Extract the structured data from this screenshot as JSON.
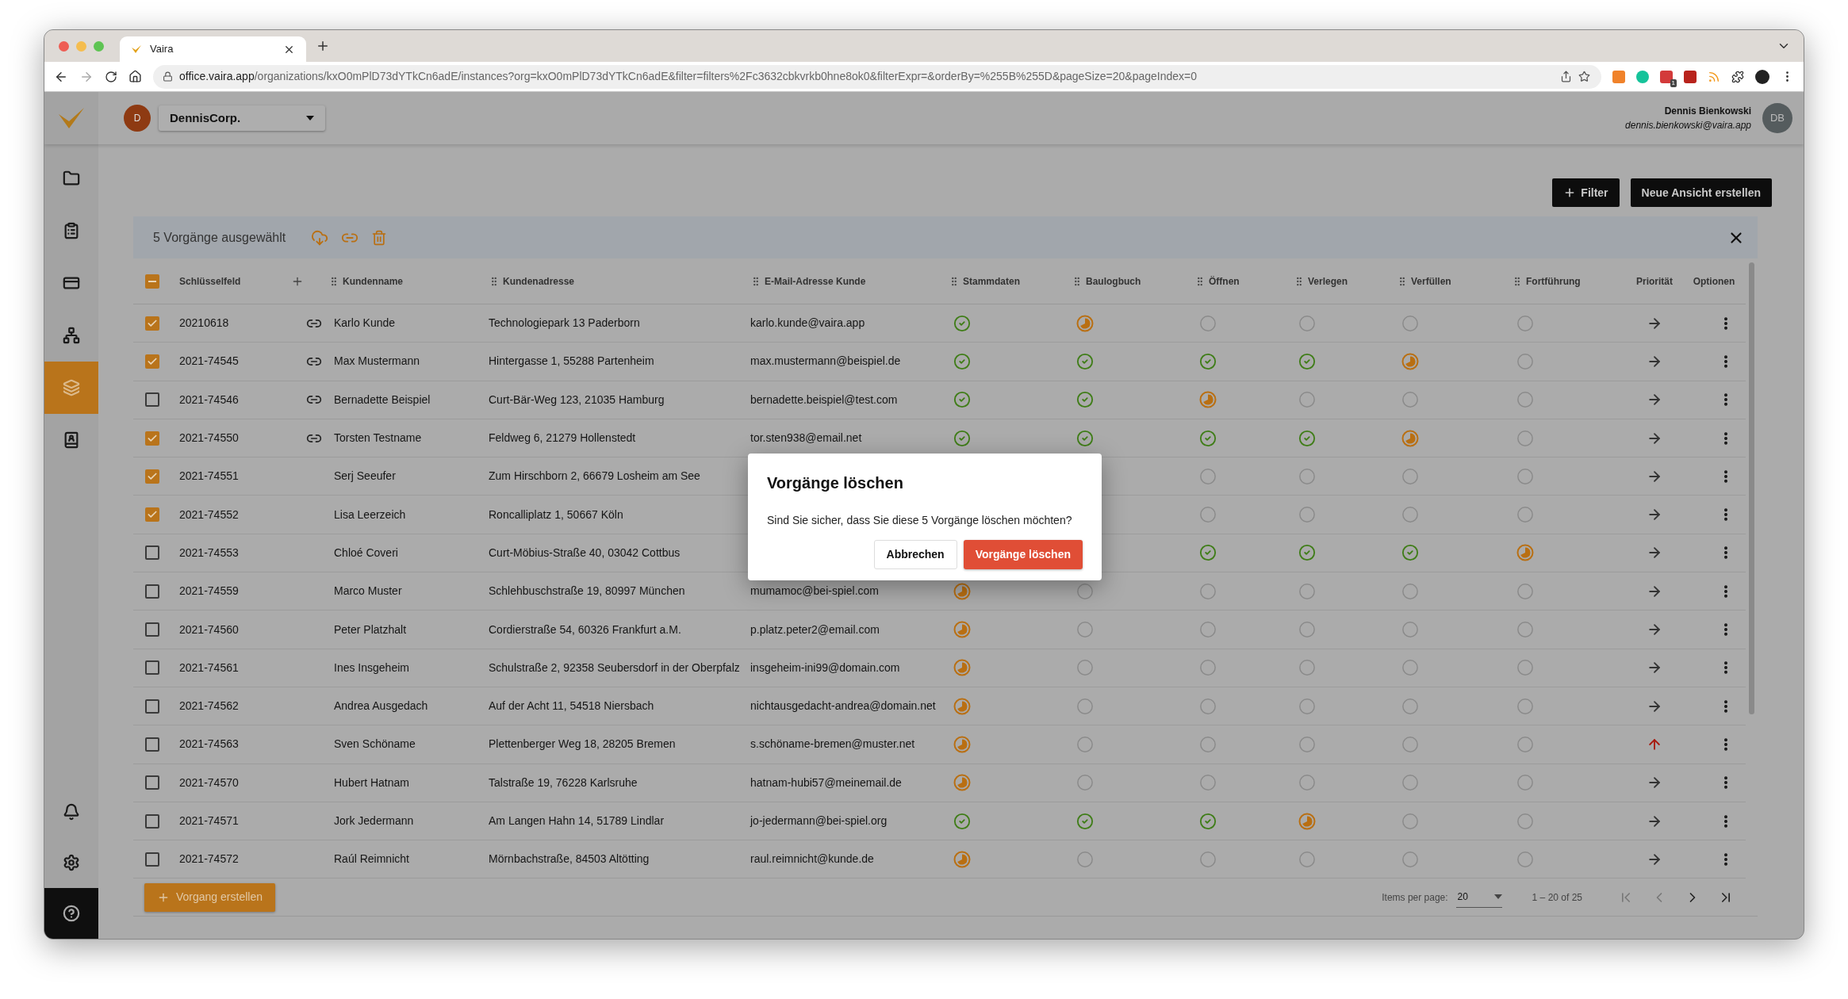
{
  "browser": {
    "tab_title": "Vaira",
    "url_host": "office.vaira.app",
    "url_path": "/organizations/kxO0mPlD73dYTkCn6adE/instances?org=kxO0mPlD73dYTkCn6adE&filter=filters%2Fc3632cbkvrkb0hne8ok0&filterExpr=&orderBy=%255B%255D&pageSize=20&pageIndex=0",
    "extension_badge": "1"
  },
  "app_header": {
    "org_avatar": "D",
    "org": "DennisCorp.",
    "user_name": "Dennis Bienkowski",
    "user_email": "dennis.bienkowski@vaira.app",
    "user_avatar": "DB"
  },
  "sidebar": {
    "items": [
      {
        "kind": "folder",
        "selected": false
      },
      {
        "kind": "clipboard",
        "selected": false
      },
      {
        "kind": "card",
        "selected": false
      },
      {
        "kind": "hierarchy",
        "selected": false
      },
      {
        "kind": "layers",
        "selected": true
      },
      {
        "kind": "contacts",
        "selected": false
      }
    ],
    "bottom_items": [
      {
        "kind": "bell"
      },
      {
        "kind": "settings"
      },
      {
        "kind": "help"
      }
    ]
  },
  "toolbar": {
    "buttons": [
      {
        "label": "Filter",
        "kind": "add"
      },
      {
        "label": "Neue Ansicht erstellen",
        "kind": "plain"
      }
    ]
  },
  "selection_bar": {
    "label": "5 Vorgänge ausgewählt"
  },
  "table": {
    "select_all_indeterminate": true,
    "columns": [
      {
        "label": "Schlüsselfeld",
        "kind": "key"
      },
      {
        "label": "Kundenname",
        "kind": "draggable"
      },
      {
        "label": "Kundenadresse",
        "kind": "draggable"
      },
      {
        "label": "E-Mail-Adresse Kunde",
        "kind": "draggable"
      },
      {
        "label": "Stammdaten",
        "kind": "draggable"
      },
      {
        "label": "Baulogbuch",
        "kind": "draggable"
      },
      {
        "label": "Öffnen",
        "kind": "draggable"
      },
      {
        "label": "Verlegen",
        "kind": "draggable"
      },
      {
        "label": "Verfüllen",
        "kind": "draggable"
      },
      {
        "label": "Fortführung",
        "kind": "draggable"
      },
      {
        "label": "Priorität",
        "kind": "plain"
      },
      {
        "label": "Optionen",
        "kind": "plain"
      }
    ],
    "rows": [
      {
        "checked": true,
        "key": "20210618",
        "linked": true,
        "name": "Karlo Kunde",
        "address": "Technologiepark 13 Paderborn",
        "email": "karlo.kunde@vaira.app",
        "steps": {
          "stammdaten": {
            "kind": "done"
          },
          "baulogbuch": {
            "kind": "partial"
          },
          "oeffnen": {
            "kind": "open"
          },
          "verlegen": {
            "kind": "open"
          },
          "verfuellen": {
            "kind": "open"
          },
          "fortfuehrung": {
            "kind": "open"
          }
        },
        "high_priority": false
      },
      {
        "checked": true,
        "key": "2021-74545",
        "linked": true,
        "name": "Max Mustermann",
        "address": "Hintergasse 1, 55288 Partenheim",
        "email": "max.mustermann@beispiel.de",
        "steps": {
          "stammdaten": {
            "kind": "done"
          },
          "baulogbuch": {
            "kind": "done"
          },
          "oeffnen": {
            "kind": "done"
          },
          "verlegen": {
            "kind": "done"
          },
          "verfuellen": {
            "kind": "partial"
          },
          "fortfuehrung": {
            "kind": "open"
          }
        },
        "high_priority": false
      },
      {
        "checked": false,
        "key": "2021-74546",
        "linked": true,
        "name": "Bernadette Beispiel",
        "address": "Curt-Bär-Weg 123, 21035 Hamburg",
        "email": "bernadette.beispiel@test.com",
        "steps": {
          "stammdaten": {
            "kind": "done"
          },
          "baulogbuch": {
            "kind": "done"
          },
          "oeffnen": {
            "kind": "partial"
          },
          "verlegen": {
            "kind": "open"
          },
          "verfuellen": {
            "kind": "open"
          },
          "fortfuehrung": {
            "kind": "open"
          }
        },
        "high_priority": false
      },
      {
        "checked": true,
        "key": "2021-74550",
        "linked": true,
        "name": "Torsten Testname",
        "address": "Feldweg 6, 21279 Hollenstedt",
        "email": "tor.sten938@email.net",
        "steps": {
          "stammdaten": {
            "kind": "done"
          },
          "baulogbuch": {
            "kind": "done"
          },
          "oeffnen": {
            "kind": "done"
          },
          "verlegen": {
            "kind": "done"
          },
          "verfuellen": {
            "kind": "partial"
          },
          "fortfuehrung": {
            "kind": "open"
          }
        },
        "high_priority": false
      },
      {
        "checked": true,
        "key": "2021-74551",
        "linked": false,
        "name": "Serj Seeufer",
        "address": "Zum Hirschborn 2, 66679 Losheim am See",
        "steps": {
          "oeffnen": {
            "kind": "open"
          },
          "verlegen": {
            "kind": "open"
          },
          "verfuellen": {
            "kind": "open"
          },
          "fortfuehrung": {
            "kind": "open"
          }
        },
        "high_priority": false
      },
      {
        "checked": true,
        "key": "2021-74552",
        "linked": false,
        "name": "Lisa Leerzeich",
        "address": "Roncalliplatz 1, 50667 Köln",
        "steps": {
          "oeffnen": {
            "kind": "open"
          },
          "verlegen": {
            "kind": "open"
          },
          "verfuellen": {
            "kind": "open"
          },
          "fortfuehrung": {
            "kind": "open"
          }
        },
        "high_priority": false
      },
      {
        "checked": false,
        "key": "2021-74553",
        "linked": false,
        "name": "Chloé Coveri",
        "address": "Curt-Möbius-Straße 40, 03042 Cottbus",
        "steps": {
          "oeffnen": {
            "kind": "done"
          },
          "verlegen": {
            "kind": "done"
          },
          "verfuellen": {
            "kind": "done"
          },
          "fortfuehrung": {
            "kind": "partial"
          }
        },
        "high_priority": false
      },
      {
        "checked": false,
        "key": "2021-74559",
        "linked": false,
        "name": "Marco Muster",
        "address": "Schlehbuschstraße 19, 80997 München",
        "email": "mumamoc@bei-spiel.com",
        "steps": {
          "stammdaten": {
            "kind": "partial"
          },
          "baulogbuch": {
            "kind": "open"
          },
          "oeffnen": {
            "kind": "open"
          },
          "verlegen": {
            "kind": "open"
          },
          "verfuellen": {
            "kind": "open"
          },
          "fortfuehrung": {
            "kind": "open"
          }
        },
        "high_priority": false
      },
      {
        "checked": false,
        "key": "2021-74560",
        "linked": false,
        "name": "Peter Platzhalt",
        "address": "Cordierstraße 54, 60326 Frankfurt a.M.",
        "email": "p.platz.peter2@email.com",
        "steps": {
          "stammdaten": {
            "kind": "partial"
          },
          "baulogbuch": {
            "kind": "open"
          },
          "oeffnen": {
            "kind": "open"
          },
          "verlegen": {
            "kind": "open"
          },
          "verfuellen": {
            "kind": "open"
          },
          "fortfuehrung": {
            "kind": "open"
          }
        },
        "high_priority": false
      },
      {
        "checked": false,
        "key": "2021-74561",
        "linked": false,
        "name": "Ines Insgeheim",
        "address": "Schulstraße 2, 92358 Seubersdorf in der Oberpfalz",
        "email": "insgeheim-ini99@domain.com",
        "steps": {
          "stammdaten": {
            "kind": "partial"
          },
          "baulogbuch": {
            "kind": "open"
          },
          "oeffnen": {
            "kind": "open"
          },
          "verlegen": {
            "kind": "open"
          },
          "verfuellen": {
            "kind": "open"
          },
          "fortfuehrung": {
            "kind": "open"
          }
        },
        "high_priority": false
      },
      {
        "checked": false,
        "key": "2021-74562",
        "linked": false,
        "name": "Andrea Ausgedach",
        "address": "Auf der Acht 11, 54518 Niersbach",
        "email": "nichtausgedacht-andrea@domain.net",
        "steps": {
          "stammdaten": {
            "kind": "partial"
          },
          "baulogbuch": {
            "kind": "open"
          },
          "oeffnen": {
            "kind": "open"
          },
          "verlegen": {
            "kind": "open"
          },
          "verfuellen": {
            "kind": "open"
          },
          "fortfuehrung": {
            "kind": "open"
          }
        },
        "high_priority": false
      },
      {
        "checked": false,
        "key": "2021-74563",
        "linked": false,
        "name": "Sven Schöname",
        "address": "Plettenberger Weg 18, 28205 Bremen",
        "email": "s.schöname-bremen@muster.net",
        "steps": {
          "stammdaten": {
            "kind": "partial"
          },
          "baulogbuch": {
            "kind": "open"
          },
          "oeffnen": {
            "kind": "open"
          },
          "verlegen": {
            "kind": "open"
          },
          "verfuellen": {
            "kind": "open"
          },
          "fortfuehrung": {
            "kind": "open"
          }
        },
        "high_priority": true
      },
      {
        "checked": false,
        "key": "2021-74570",
        "linked": false,
        "name": "Hubert Hatnam",
        "address": "Talstraße 19, 76228 Karlsruhe",
        "email": "hatnam-hubi57@meinemail.de",
        "steps": {
          "stammdaten": {
            "kind": "partial"
          },
          "baulogbuch": {
            "kind": "open"
          },
          "oeffnen": {
            "kind": "open"
          },
          "verlegen": {
            "kind": "open"
          },
          "verfuellen": {
            "kind": "open"
          },
          "fortfuehrung": {
            "kind": "open"
          }
        },
        "high_priority": false
      },
      {
        "checked": false,
        "key": "2021-74571",
        "linked": false,
        "name": "Jork Jedermann",
        "address": "Am Langen Hahn 14, 51789 Lindlar",
        "email": "jo-jedermann@bei-spiel.org",
        "steps": {
          "stammdaten": {
            "kind": "done"
          },
          "baulogbuch": {
            "kind": "done"
          },
          "oeffnen": {
            "kind": "done"
          },
          "verlegen": {
            "kind": "partial"
          },
          "verfuellen": {
            "kind": "open"
          },
          "fortfuehrung": {
            "kind": "open"
          }
        },
        "high_priority": false
      },
      {
        "checked": false,
        "key": "2021-74572",
        "linked": false,
        "name": "Raúl Reimnicht",
        "address": "Mörnbachstraße, 84503 Altötting",
        "email": "raul.reimnicht@kunde.de",
        "steps": {
          "stammdaten": {
            "kind": "partial"
          },
          "baulogbuch": {
            "kind": "open"
          },
          "oeffnen": {
            "kind": "open"
          },
          "verlegen": {
            "kind": "open"
          },
          "verfuellen": {
            "kind": "open"
          },
          "fortfuehrung": {
            "kind": "open"
          }
        },
        "high_priority": false
      }
    ]
  },
  "footer": {
    "create_button": "Vorgang erstellen",
    "items_per_page_label": "Items per page:",
    "items_per_page": "20",
    "range": "1 – 20 of 25"
  },
  "dialog": {
    "title": "Vorgänge löschen",
    "message": "Sind Sie sicher, dass Sie diese 5 Vorgänge löschen möchten?",
    "buttons": [
      {
        "label": "Abbrechen",
        "kind": "secondary"
      },
      {
        "label": "Vorgänge löschen",
        "kind": "danger"
      }
    ]
  }
}
